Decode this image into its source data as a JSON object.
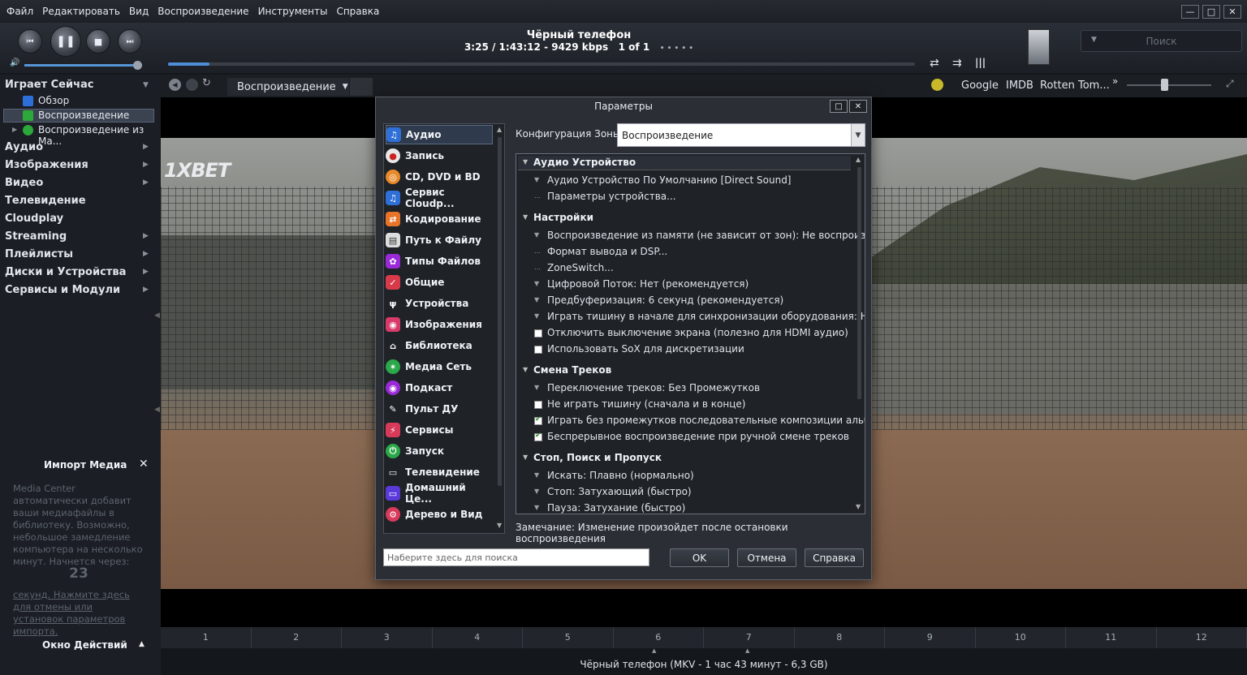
{
  "menu": [
    "Файл",
    "Редактировать",
    "Вид",
    "Воспроизведение",
    "Инструменты",
    "Справка"
  ],
  "now_playing": {
    "title": "Чёрный телефон",
    "info": "3:25 / 1:43:12 - 9429 kbps",
    "of": "1 of 1",
    "dots": "• • • • •",
    "progress": 0.055
  },
  "search": {
    "placeholder": "Поиск"
  },
  "toolbar": {
    "view_label": "Воспроизведение",
    "links": [
      "Google",
      "IMDB",
      "Rotten Tom..."
    ],
    "more": "»"
  },
  "sidebar": {
    "now_playing": "Играет Сейчас",
    "sub": [
      "Обзор",
      "Воспроизведение",
      "Воспроизведение из Ма..."
    ],
    "categories": [
      "Аудио",
      "Изображения",
      "Видео",
      "Телевидение",
      "Cloudplay",
      "Streaming",
      "Плейлисты",
      "Диски и Устройства",
      "Сервисы и Модули"
    ]
  },
  "overlay_logo": "1XBET",
  "import": {
    "title": "Импорт Медиа",
    "text1": "Media Center автоматически добавит ваши медиафайлы в библиотеку. Возможно, небольшое замедление компьютера на несколько минут. Начнется через:",
    "countdown": "23",
    "text2": "секунд. Нажмите здесь для отмены или установок параметров импорта.",
    "actions": "Окно Действий"
  },
  "chapters": [
    "1",
    "2",
    "3",
    "4",
    "5",
    "6",
    "7",
    "8",
    "9",
    "10",
    "11",
    "12"
  ],
  "status": "Чёрный телефон (MKV - 1 час 43 минут - 6,3 GB)",
  "dialog": {
    "title": "Параметры",
    "categories": [
      "Аудио",
      "Запись",
      "CD, DVD и BD",
      "Сервис Cloudp...",
      "Кодирование",
      "Путь к Файлу",
      "Типы Файлов",
      "Общие",
      "Устройства",
      "Изображения",
      "Библиотека",
      "Медиа Сеть",
      "Подкаст",
      "Пульт ДУ",
      "Сервисы",
      "Запуск",
      "Телевидение",
      "Домашний Це...",
      "Дерево и Вид"
    ],
    "zone_label": "Конфигурация Зоны:",
    "zone_value": "Воспроизведение",
    "sections": [
      {
        "title": "Аудио Устройство",
        "rows": [
          {
            "t": "Аудио Устройство По Умолчанию [Direct Sound]",
            "k": "dd"
          },
          {
            "t": "Параметры устройства...",
            "k": "dots"
          }
        ]
      },
      {
        "title": "Настройки",
        "rows": [
          {
            "t": "Воспроизведение из памяти (не зависит от зон): Не воспроизвод...",
            "k": "dd"
          },
          {
            "t": "Формат вывода и DSP...",
            "k": "dots"
          },
          {
            "t": "ZoneSwitch...",
            "k": "dots"
          },
          {
            "t": "Цифровой Поток: Нет (рекомендуется)",
            "k": "dd"
          },
          {
            "t": "Предбуферизация: 6 секунд (рекомендуется)",
            "k": "dd"
          },
          {
            "t": "Играть тишину в начале для синхронизации оборудования: Нет",
            "k": "dd"
          },
          {
            "t": "Отключить выключение экрана (полезно для HDMI аудио)",
            "k": "off"
          },
          {
            "t": "Использовать SoX для дискретизации",
            "k": "off"
          }
        ]
      },
      {
        "title": "Смена Треков",
        "rows": [
          {
            "t": "Переключение треков: Без Промежутков",
            "k": "dd"
          },
          {
            "t": "Не играть тишину (сначала и в конце)",
            "k": "off"
          },
          {
            "t": "Играть без промежутков последовательные композиции альбома",
            "k": "on"
          },
          {
            "t": "Беспрерывное воспроизведение при ручной смене треков",
            "k": "on"
          }
        ]
      },
      {
        "title": "Стоп, Поиск и Пропуск",
        "rows": [
          {
            "t": "Искать: Плавно (нормально)",
            "k": "dd"
          },
          {
            "t": "Стоп: Затухающий (быстро)",
            "k": "dd"
          },
          {
            "t": "Пауза: Затухание (быстро)",
            "k": "dd"
          }
        ]
      }
    ],
    "note": "Замечание: Изменение произойдет после остановки воспроизведения",
    "search_placeholder": "Наберите здесь для поиска",
    "ok": "OK",
    "cancel": "Отмена",
    "help": "Справка"
  }
}
